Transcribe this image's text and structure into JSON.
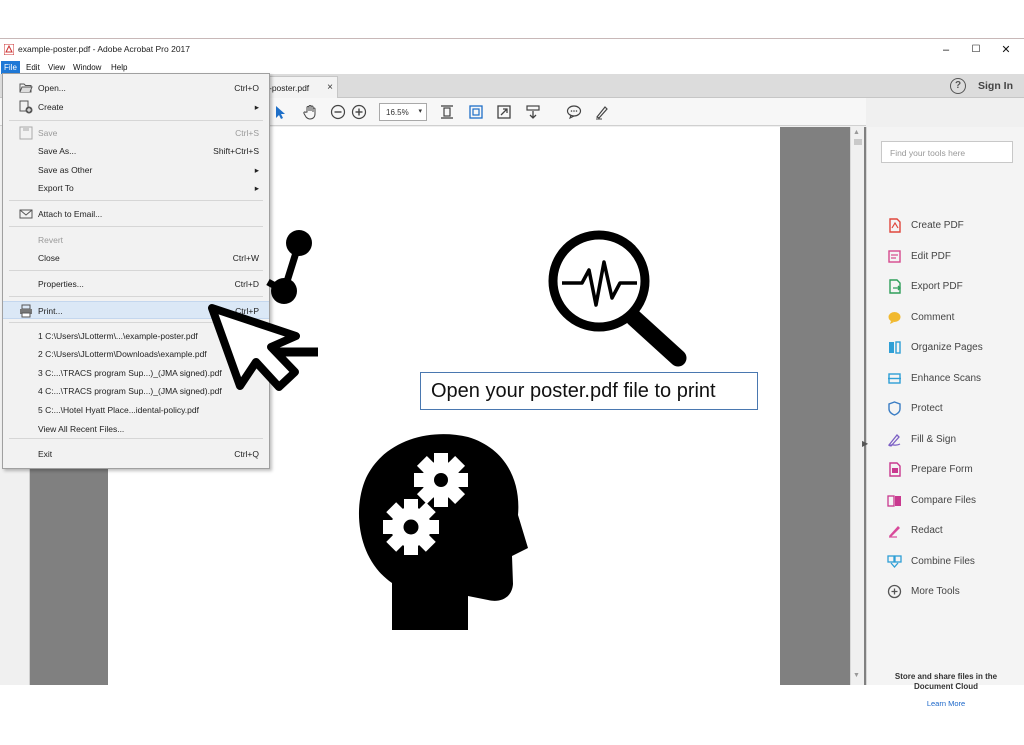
{
  "window": {
    "title": "example-poster.pdf - Adobe Acrobat Pro 2017",
    "minimize": "–",
    "maximize": "☐",
    "close": "✕"
  },
  "menubar": [
    "File",
    "Edit",
    "View",
    "Window",
    "Help"
  ],
  "tab": {
    "label": "-poster.pdf",
    "close": "×"
  },
  "header": {
    "help": "?",
    "sign_in": "Sign In"
  },
  "toolbar": {
    "zoom": "16.5%"
  },
  "file_menu": {
    "items": [
      {
        "label": "Open...",
        "shortcut": "Ctrl+O",
        "icon": "open-folder-icon"
      },
      {
        "label": "Create",
        "shortcut": "▸",
        "icon": "create-icon"
      },
      {
        "label": "Save",
        "shortcut": "Ctrl+S",
        "icon": "save-icon",
        "disabled": true
      },
      {
        "label": "Save As...",
        "shortcut": "Shift+Ctrl+S"
      },
      {
        "label": "Save as Other",
        "shortcut": "▸"
      },
      {
        "label": "Export To",
        "shortcut": "▸"
      },
      {
        "label": "Attach to Email...",
        "icon": "envelope-icon"
      },
      {
        "label": "Revert",
        "disabled": true
      },
      {
        "label": "Close",
        "shortcut": "Ctrl+W"
      },
      {
        "label": "Properties...",
        "shortcut": "Ctrl+D"
      },
      {
        "label": "Print...",
        "shortcut": "Ctrl+P",
        "icon": "printer-icon",
        "highlighted": true
      },
      {
        "label": "1 C:\\Users\\JLotterm\\...\\example-poster.pdf"
      },
      {
        "label": "2 C:\\Users\\JLotterm\\Downloads\\example.pdf"
      },
      {
        "label": "3 C:...\\TRACS program Sup...)_(JMA signed).pdf"
      },
      {
        "label": "4 C:...\\TRACS program Sup...)_(JMA signed).pdf"
      },
      {
        "label": "5 C:...\\Hotel Hyatt Place...idental-policy.pdf"
      },
      {
        "label": "View All Recent Files..."
      },
      {
        "label": "Exit",
        "shortcut": "Ctrl+Q"
      }
    ]
  },
  "document": {
    "caption": "Open your poster.pdf file to print"
  },
  "tools_pane": {
    "search_placeholder": "Find your tools here",
    "tools": [
      {
        "label": "Create PDF",
        "icon": "create-pdf-icon",
        "color": "#e0463c"
      },
      {
        "label": "Edit PDF",
        "icon": "edit-pdf-icon",
        "color": "#d6498d"
      },
      {
        "label": "Export PDF",
        "icon": "export-pdf-icon",
        "color": "#2f9e5a"
      },
      {
        "label": "Comment",
        "icon": "comment-icon",
        "color": "#f1b92f"
      },
      {
        "label": "Organize Pages",
        "icon": "organize-pages-icon",
        "color": "#2e9fd6"
      },
      {
        "label": "Enhance Scans",
        "icon": "enhance-scans-icon",
        "color": "#2e9fd6"
      },
      {
        "label": "Protect",
        "icon": "shield-icon",
        "color": "#3a7dc4"
      },
      {
        "label": "Fill & Sign",
        "icon": "fill-sign-icon",
        "color": "#7b5fc4"
      },
      {
        "label": "Prepare Form",
        "icon": "prepare-form-icon",
        "color": "#c9398f"
      },
      {
        "label": "Compare Files",
        "icon": "compare-files-icon",
        "color": "#c9398f"
      },
      {
        "label": "Redact",
        "icon": "redact-icon",
        "color": "#d84a9a"
      },
      {
        "label": "Combine Files",
        "icon": "combine-files-icon",
        "color": "#2e9fd6"
      },
      {
        "label": "More Tools",
        "icon": "plus-circle-icon",
        "color": "#555555"
      }
    ],
    "cloud_text": "Store and share files in the Document Cloud",
    "learn_more": "Learn More"
  }
}
